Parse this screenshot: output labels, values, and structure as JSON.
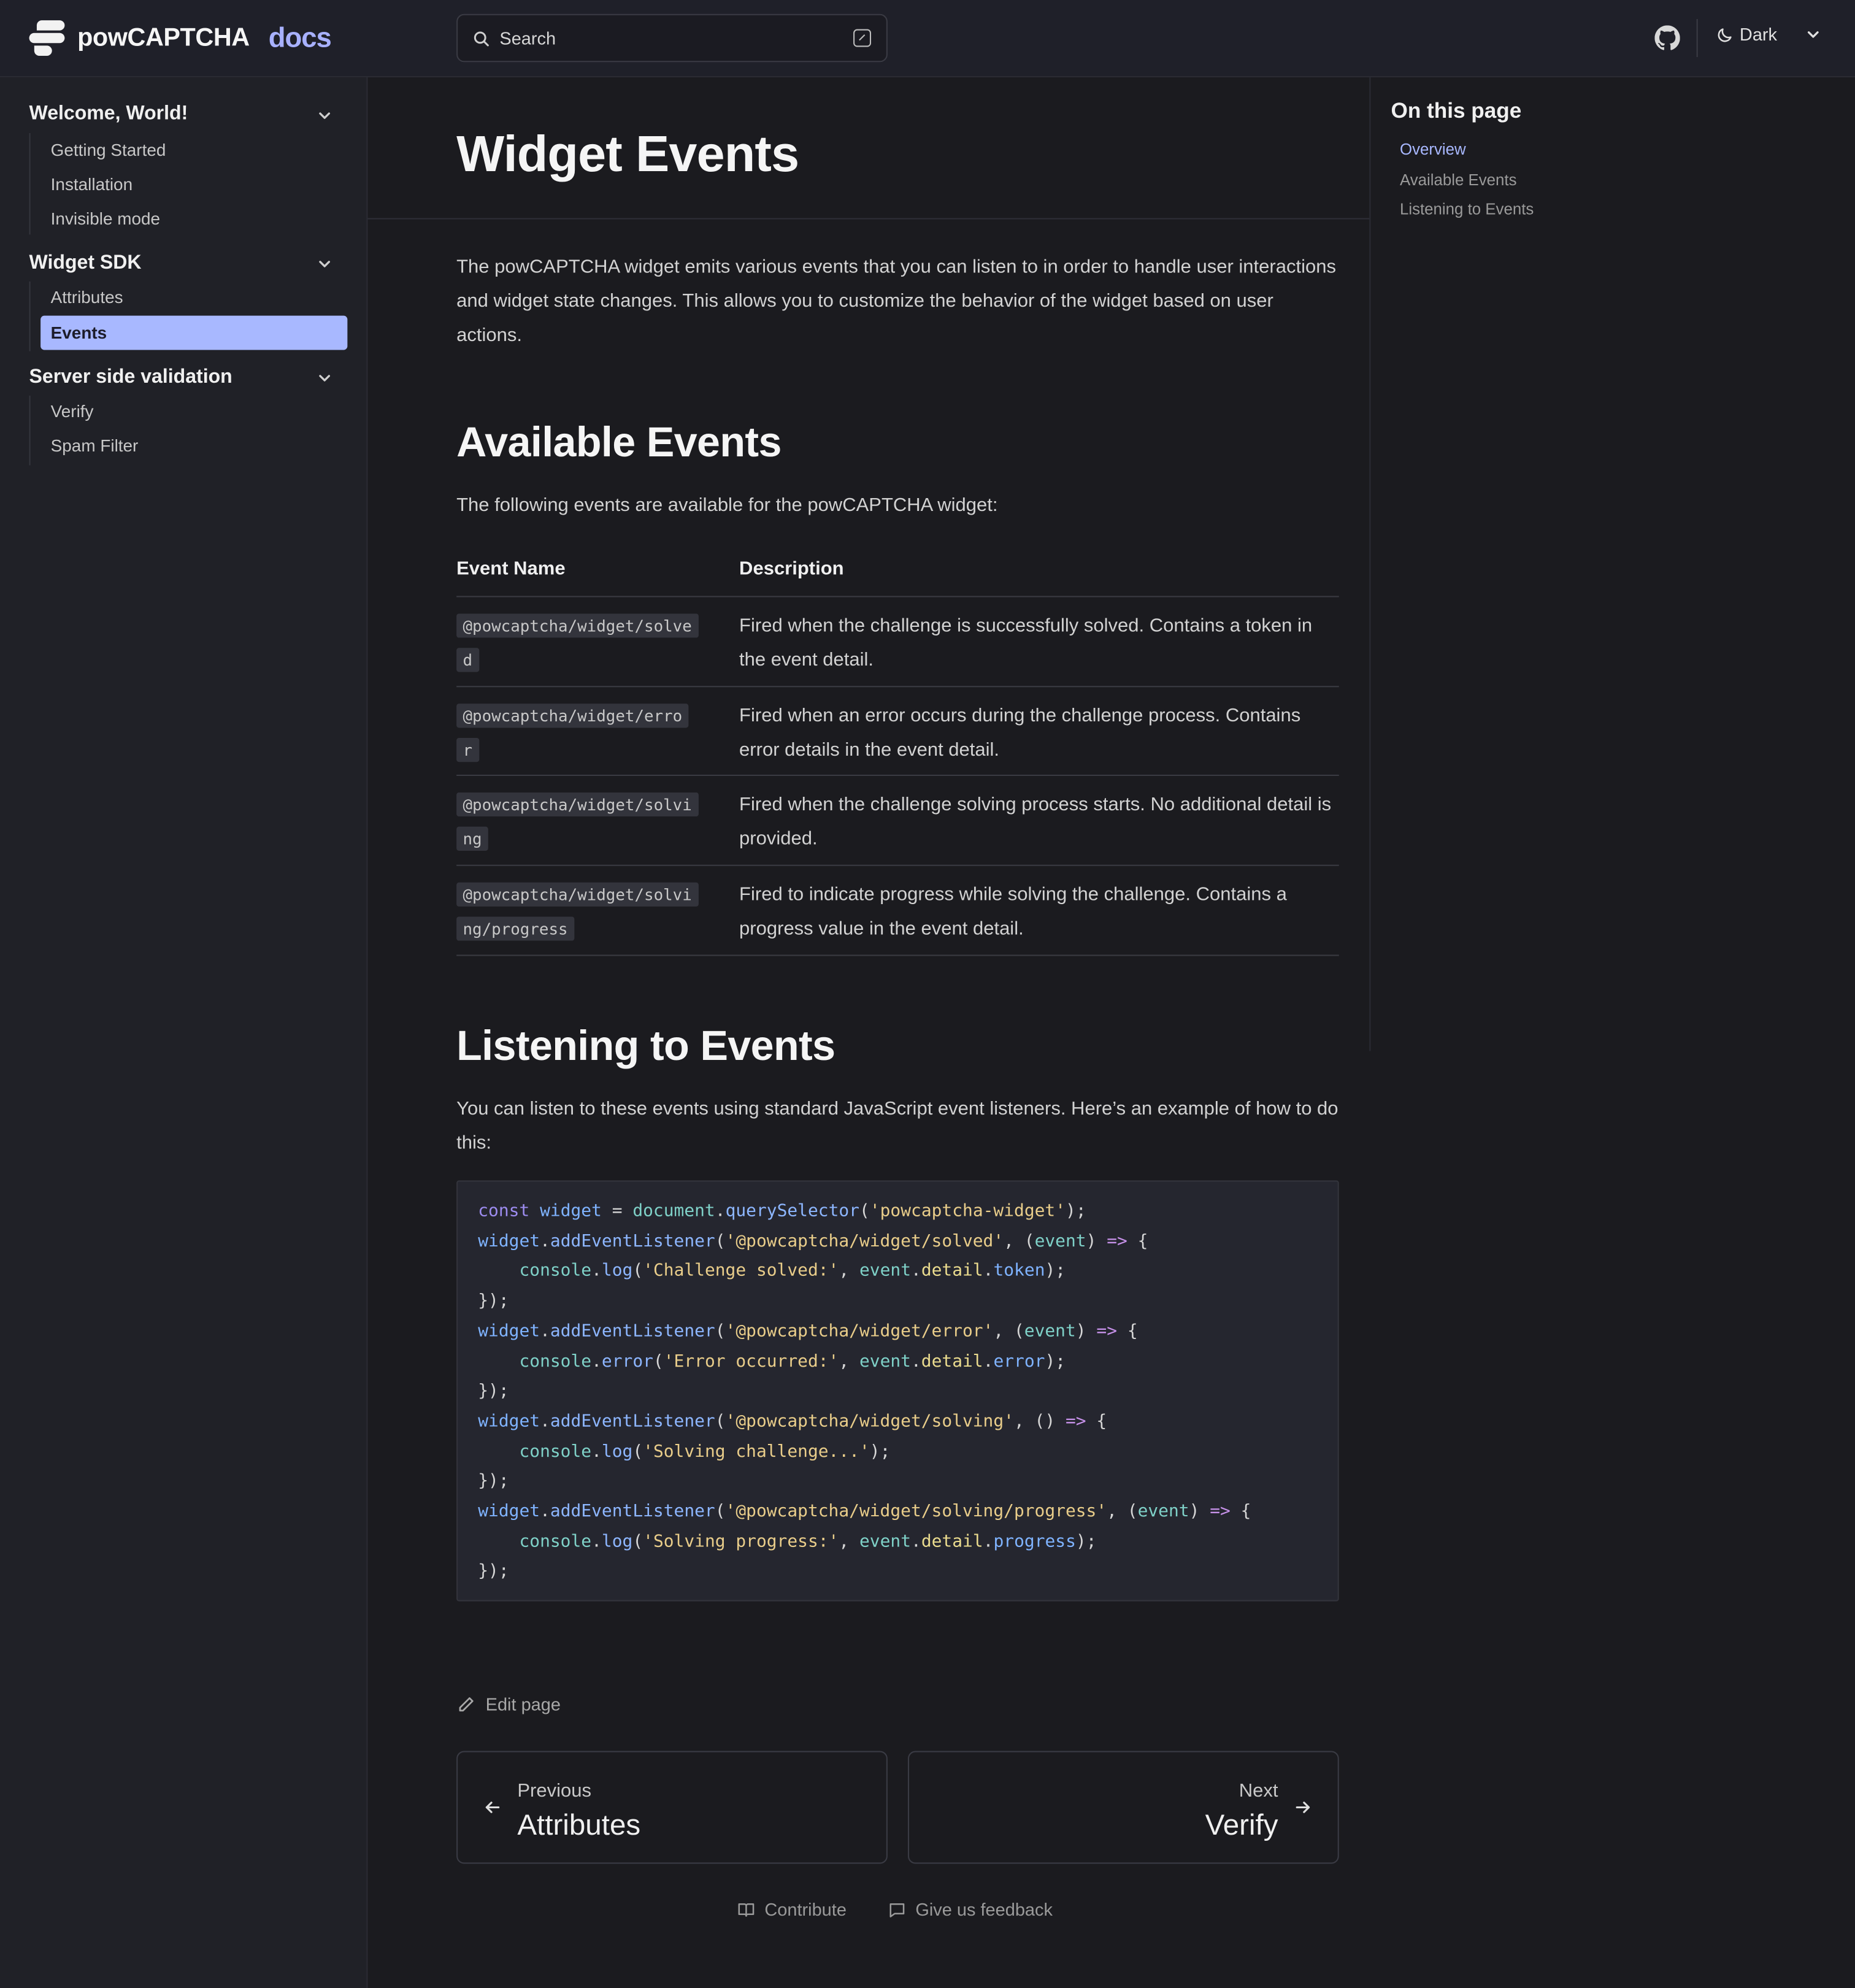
{
  "header": {
    "brand": "powCAPTCHA",
    "brand_suffix": "docs",
    "search_label": "Search",
    "theme_label": "Dark"
  },
  "sidebar": {
    "sections": [
      {
        "title": "Welcome, World!",
        "items": [
          "Getting Started",
          "Installation",
          "Invisible mode"
        ]
      },
      {
        "title": "Widget SDK",
        "items": [
          "Attributes",
          "Events"
        ],
        "active": "Events"
      },
      {
        "title": "Server side validation",
        "items": [
          "Verify",
          "Spam Filter"
        ]
      }
    ]
  },
  "main": {
    "title": "Widget Events",
    "intro": "The powCAPTCHA widget emits various events that you can listen to in order to handle user interactions and widget state changes. This allows you to customize the behavior of the widget based on user actions.",
    "available": {
      "heading": "Available Events",
      "lead": "The following events are available for the powCAPTCHA widget:",
      "columns": [
        "Event Name",
        "Description"
      ],
      "rows": [
        {
          "name": "@powcaptcha/widget/solved",
          "desc": "Fired when the challenge is successfully solved. Contains a token in the event detail."
        },
        {
          "name": "@powcaptcha/widget/error",
          "desc": "Fired when an error occurs during the challenge process. Contains error details in the event detail."
        },
        {
          "name": "@powcaptcha/widget/solving",
          "desc": "Fired when the challenge solving process starts. No additional detail is provided."
        },
        {
          "name": "@powcaptcha/widget/solving/progress",
          "desc": "Fired to indicate progress while solving the challenge. Contains a progress value in the event detail."
        }
      ]
    },
    "listening": {
      "heading": "Listening to Events",
      "lead": "You can listen to these events using standard JavaScript event listeners. Here’s an example of how to do this:",
      "code": [
        "const widget = document.querySelector('powcaptcha-widget');",
        "widget.addEventListener('@powcaptcha/widget/solved', (event) => {",
        "    console.log('Challenge solved:', event.detail.token);",
        "});",
        "widget.addEventListener('@powcaptcha/widget/error', (event) => {",
        "    console.error('Error occurred:', event.detail.error);",
        "});",
        "widget.addEventListener('@powcaptcha/widget/solving', () => {",
        "    console.log('Solving challenge...');",
        "});",
        "widget.addEventListener('@powcaptcha/widget/solving/progress', (event) => {",
        "    console.log('Solving progress:', event.detail.progress);",
        "});"
      ]
    },
    "edit_label": "Edit page",
    "prev": {
      "label": "Previous",
      "title": "Attributes"
    },
    "next": {
      "label": "Next",
      "title": "Verify"
    },
    "footer": {
      "contribute": "Contribute",
      "feedback": "Give us feedback"
    }
  },
  "toc": {
    "title": "On this page",
    "items": [
      "Overview",
      "Available Events",
      "Listening to Events"
    ],
    "active": "Overview"
  },
  "colors": {
    "accent": "#a8b8ff",
    "background": "#1b1b1f",
    "sidebar": "#202127"
  },
  "icons": [
    "logo-icon",
    "search-icon",
    "keyboard-shortcut-icon",
    "github-icon",
    "moon-icon",
    "chevron-down-icon",
    "pencil-icon",
    "arrow-left-icon",
    "arrow-right-icon",
    "book-icon",
    "chat-icon"
  ]
}
